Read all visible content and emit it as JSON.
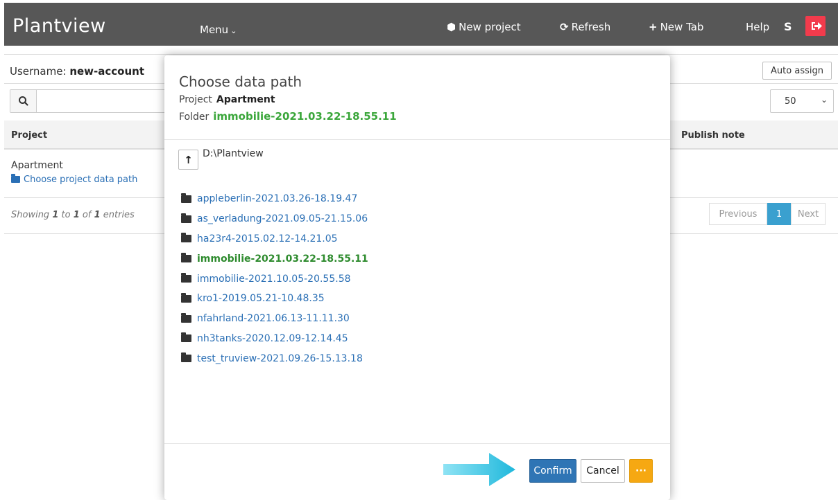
{
  "header": {
    "brand": "Plantview",
    "menu_label": "Menu",
    "new_project": "New project",
    "refresh": "Refresh",
    "new_tab": "New Tab",
    "help": "Help",
    "user_initial": "S",
    "icons": {
      "new_project": "cube-icon",
      "refresh": "refresh-icon",
      "new_tab": "plus-icon",
      "logout": "sign-out-icon"
    },
    "logout_color": "#f23b4c"
  },
  "page": {
    "username_label": "Username:",
    "username_value": "new-account",
    "auto_assign": "Auto assign",
    "per_page": "50",
    "columns": {
      "project": "Project",
      "publish_note": "Publish note"
    },
    "rows": [
      {
        "project": "Apartment",
        "link": "Choose project data path"
      }
    ],
    "showing": {
      "prefix": "Showing",
      "from": "1",
      "to_word": "to",
      "to": "1",
      "of_word": "of",
      "total": "1",
      "suffix": "entries"
    },
    "pagination": {
      "previous": "Previous",
      "current": "1",
      "next": "Next"
    }
  },
  "modal": {
    "title": "Choose data path",
    "project_label": "Project",
    "project_value": "Apartment",
    "folder_label": "Folder",
    "folder_value": "immobilie-2021.03.22-18.55.11",
    "up_button": "↑",
    "current_path": "D:\\Plantview",
    "folders": [
      "appleberlin-2021.03.26-18.19.47",
      "as_verladung-2021.09.05-21.15.06",
      "ha23r4-2015.02.12-14.21.05",
      "immobilie-2021.03.22-18.55.11",
      "immobilie-2021.10.05-20.55.58",
      "kro1-2019.05.21-10.48.35",
      "nfahrland-2021.06.13-11.11.30",
      "nh3tanks-2020.12.09-12.14.45",
      "test_truview-2021.09.26-15.13.18"
    ],
    "active_folder_index": 3,
    "confirm": "Confirm",
    "cancel": "Cancel",
    "more": "···",
    "colors": {
      "confirm": "#2f75b5",
      "more": "#f6a812",
      "active_folder": "#2e8b2e",
      "link": "#2a6fb5",
      "arrow": "#1fb8dc"
    }
  }
}
